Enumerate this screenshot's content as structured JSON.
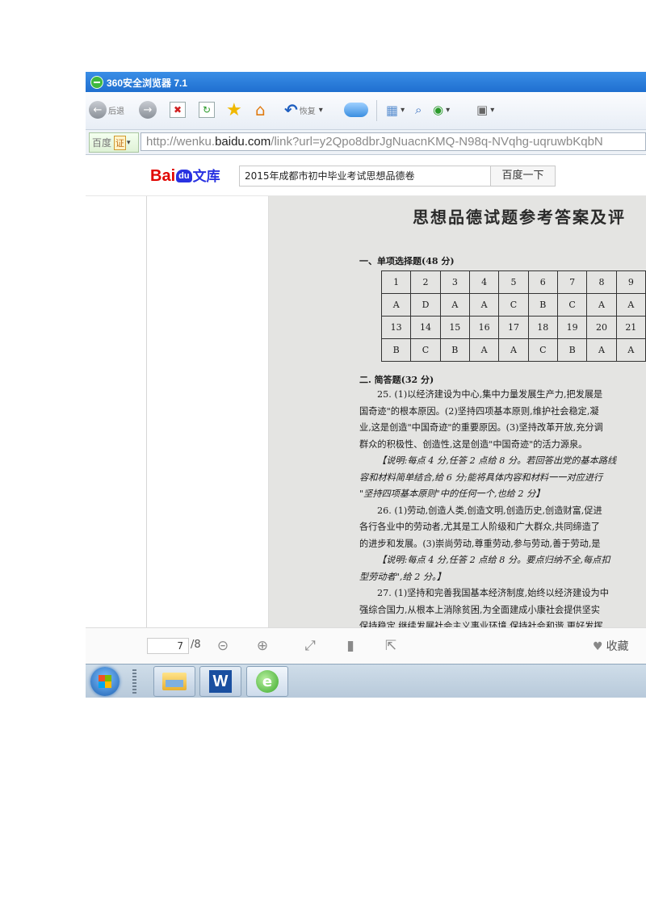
{
  "browser": {
    "title": "360安全浏览器 7.1",
    "back_label": "后退",
    "restore_label": "恢复",
    "id_label": "百度",
    "id_badge": "证",
    "address": {
      "prefix": "http://wenku.",
      "domain": "baidu.com",
      "path": "/link?url=y2Qpo8dbrJgNuacnKMQ-N98q-NVqhg-uqruwbKqbN"
    }
  },
  "baidu": {
    "logo_bai": "Bai",
    "logo_paw": "du",
    "logo_wenku": "文库",
    "search_value": "2015年成都市初中毕业考试思想品德卷",
    "search_button": "百度一下"
  },
  "document": {
    "title": "思想品德试题参考答案及评",
    "section1": "一、单项选择题(48 分)",
    "answer_table": [
      [
        "1",
        "2",
        "3",
        "4",
        "5",
        "6",
        "7",
        "8",
        "9"
      ],
      [
        "A",
        "D",
        "A",
        "A",
        "C",
        "B",
        "C",
        "A",
        "A"
      ],
      [
        "13",
        "14",
        "15",
        "16",
        "17",
        "18",
        "19",
        "20",
        "21"
      ],
      [
        "B",
        "C",
        "B",
        "A",
        "A",
        "C",
        "B",
        "A",
        "A"
      ]
    ],
    "section2": "二. 简答题(32 分)",
    "lines": [
      "25. (1)以经济建设为中心,集中力量发展生产力,把发展是",
      "国奇迹\"的根本原因。(2)坚持四项基本原则,维护社会稳定,凝",
      "业,这是创造\"中国奇迹\"的重要原因。(3)坚持改革开放,充分调",
      "群众的积极性、创造性,这是创造\"中国奇迹\"的活力源泉。",
      "【说明:每点 4 分,任答 2 点给 8 分。若回答出党的基本路线",
      "容和材料简单结合,给 6 分;能将具体内容和材料一一对应进行",
      "\"坚持四项基本原则\"中的任何一个,也给 2 分】",
      "26. (1)劳动,创造人类,创造文明,创造历史,创造财富,促进",
      "各行各业中的劳动者,尤其是工人阶级和广大群众,共同缔造了",
      "的进步和发展。(3)崇尚劳动,尊重劳动,参与劳动,善于劳动,是",
      "【说明:每点 4 分,任答 2 点给 8 分。要点归纳不全,每点扣",
      "型劳动者\",给 2 分。】",
      "27. (1)坚持和完善我国基本经济制度,始终以经济建设为中",
      "强综合国力,从根本上消除贫困,为全面建成小康社会提供坚实",
      "保持稳定,继续发展社会主义事业环境,保持社会和谐,更好发挥"
    ]
  },
  "viewer": {
    "page_current": "7",
    "page_total": "/8",
    "favorite": "收藏"
  },
  "icons": {
    "back": "back-arrow-icon",
    "forward": "forward-arrow-icon",
    "favorite_star": "star-icon",
    "home": "home-icon",
    "undo": "undo-icon",
    "cloud": "cloud-icon"
  }
}
